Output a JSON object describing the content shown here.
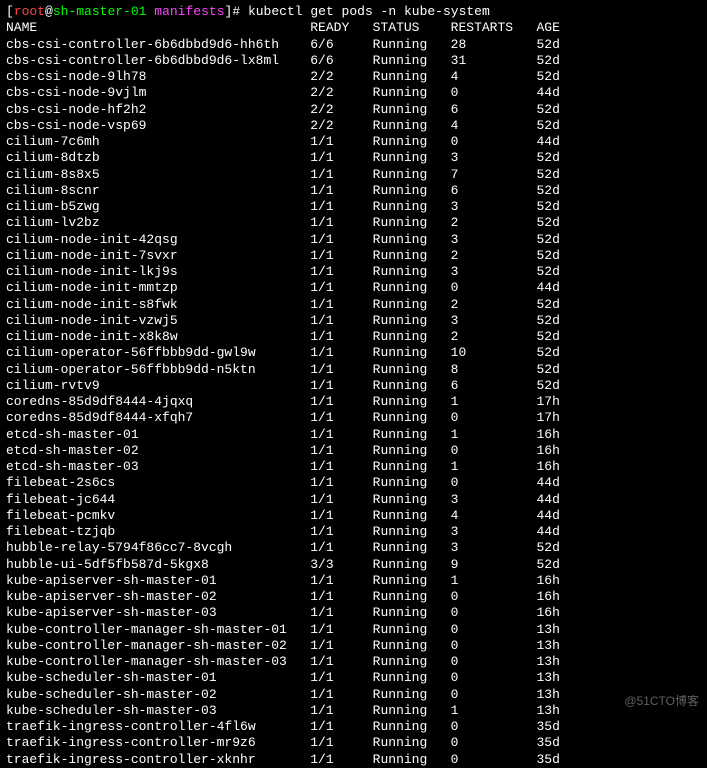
{
  "prompt": {
    "user": "root",
    "at": "@",
    "host": "sh-master-01",
    "space": " ",
    "path": "manifests",
    "hash": "#",
    "command": "kubectl get pods -n kube-system"
  },
  "headers": [
    "NAME",
    "READY",
    "STATUS",
    "RESTARTS",
    "AGE"
  ],
  "rows": [
    {
      "name": "cbs-csi-controller-6b6dbbd9d6-hh6th",
      "ready": "6/6",
      "status": "Running",
      "restarts": "28",
      "age": "52d"
    },
    {
      "name": "cbs-csi-controller-6b6dbbd9d6-lx8ml",
      "ready": "6/6",
      "status": "Running",
      "restarts": "31",
      "age": "52d"
    },
    {
      "name": "cbs-csi-node-9lh78",
      "ready": "2/2",
      "status": "Running",
      "restarts": "4",
      "age": "52d"
    },
    {
      "name": "cbs-csi-node-9vjlm",
      "ready": "2/2",
      "status": "Running",
      "restarts": "0",
      "age": "44d"
    },
    {
      "name": "cbs-csi-node-hf2h2",
      "ready": "2/2",
      "status": "Running",
      "restarts": "6",
      "age": "52d"
    },
    {
      "name": "cbs-csi-node-vsp69",
      "ready": "2/2",
      "status": "Running",
      "restarts": "4",
      "age": "52d"
    },
    {
      "name": "cilium-7c6mh",
      "ready": "1/1",
      "status": "Running",
      "restarts": "0",
      "age": "44d"
    },
    {
      "name": "cilium-8dtzb",
      "ready": "1/1",
      "status": "Running",
      "restarts": "3",
      "age": "52d"
    },
    {
      "name": "cilium-8s8x5",
      "ready": "1/1",
      "status": "Running",
      "restarts": "7",
      "age": "52d"
    },
    {
      "name": "cilium-8scnr",
      "ready": "1/1",
      "status": "Running",
      "restarts": "6",
      "age": "52d"
    },
    {
      "name": "cilium-b5zwg",
      "ready": "1/1",
      "status": "Running",
      "restarts": "3",
      "age": "52d"
    },
    {
      "name": "cilium-lv2bz",
      "ready": "1/1",
      "status": "Running",
      "restarts": "2",
      "age": "52d"
    },
    {
      "name": "cilium-node-init-42qsg",
      "ready": "1/1",
      "status": "Running",
      "restarts": "3",
      "age": "52d"
    },
    {
      "name": "cilium-node-init-7svxr",
      "ready": "1/1",
      "status": "Running",
      "restarts": "2",
      "age": "52d"
    },
    {
      "name": "cilium-node-init-lkj9s",
      "ready": "1/1",
      "status": "Running",
      "restarts": "3",
      "age": "52d"
    },
    {
      "name": "cilium-node-init-mmtzp",
      "ready": "1/1",
      "status": "Running",
      "restarts": "0",
      "age": "44d"
    },
    {
      "name": "cilium-node-init-s8fwk",
      "ready": "1/1",
      "status": "Running",
      "restarts": "2",
      "age": "52d"
    },
    {
      "name": "cilium-node-init-vzwj5",
      "ready": "1/1",
      "status": "Running",
      "restarts": "3",
      "age": "52d"
    },
    {
      "name": "cilium-node-init-x8k8w",
      "ready": "1/1",
      "status": "Running",
      "restarts": "2",
      "age": "52d"
    },
    {
      "name": "cilium-operator-56ffbbb9dd-gwl9w",
      "ready": "1/1",
      "status": "Running",
      "restarts": "10",
      "age": "52d"
    },
    {
      "name": "cilium-operator-56ffbbb9dd-n5ktn",
      "ready": "1/1",
      "status": "Running",
      "restarts": "8",
      "age": "52d"
    },
    {
      "name": "cilium-rvtv9",
      "ready": "1/1",
      "status": "Running",
      "restarts": "6",
      "age": "52d"
    },
    {
      "name": "coredns-85d9df8444-4jqxq",
      "ready": "1/1",
      "status": "Running",
      "restarts": "1",
      "age": "17h"
    },
    {
      "name": "coredns-85d9df8444-xfqh7",
      "ready": "1/1",
      "status": "Running",
      "restarts": "0",
      "age": "17h"
    },
    {
      "name": "etcd-sh-master-01",
      "ready": "1/1",
      "status": "Running",
      "restarts": "1",
      "age": "16h"
    },
    {
      "name": "etcd-sh-master-02",
      "ready": "1/1",
      "status": "Running",
      "restarts": "0",
      "age": "16h"
    },
    {
      "name": "etcd-sh-master-03",
      "ready": "1/1",
      "status": "Running",
      "restarts": "1",
      "age": "16h"
    },
    {
      "name": "filebeat-2s6cs",
      "ready": "1/1",
      "status": "Running",
      "restarts": "0",
      "age": "44d"
    },
    {
      "name": "filebeat-jc644",
      "ready": "1/1",
      "status": "Running",
      "restarts": "3",
      "age": "44d"
    },
    {
      "name": "filebeat-pcmkv",
      "ready": "1/1",
      "status": "Running",
      "restarts": "4",
      "age": "44d"
    },
    {
      "name": "filebeat-tzjqb",
      "ready": "1/1",
      "status": "Running",
      "restarts": "3",
      "age": "44d"
    },
    {
      "name": "hubble-relay-5794f86cc7-8vcgh",
      "ready": "1/1",
      "status": "Running",
      "restarts": "3",
      "age": "52d"
    },
    {
      "name": "hubble-ui-5df5fb587d-5kgx8",
      "ready": "3/3",
      "status": "Running",
      "restarts": "9",
      "age": "52d"
    },
    {
      "name": "kube-apiserver-sh-master-01",
      "ready": "1/1",
      "status": "Running",
      "restarts": "1",
      "age": "16h"
    },
    {
      "name": "kube-apiserver-sh-master-02",
      "ready": "1/1",
      "status": "Running",
      "restarts": "0",
      "age": "16h"
    },
    {
      "name": "kube-apiserver-sh-master-03",
      "ready": "1/1",
      "status": "Running",
      "restarts": "0",
      "age": "16h"
    },
    {
      "name": "kube-controller-manager-sh-master-01",
      "ready": "1/1",
      "status": "Running",
      "restarts": "0",
      "age": "13h"
    },
    {
      "name": "kube-controller-manager-sh-master-02",
      "ready": "1/1",
      "status": "Running",
      "restarts": "0",
      "age": "13h"
    },
    {
      "name": "kube-controller-manager-sh-master-03",
      "ready": "1/1",
      "status": "Running",
      "restarts": "0",
      "age": "13h"
    },
    {
      "name": "kube-scheduler-sh-master-01",
      "ready": "1/1",
      "status": "Running",
      "restarts": "0",
      "age": "13h"
    },
    {
      "name": "kube-scheduler-sh-master-02",
      "ready": "1/1",
      "status": "Running",
      "restarts": "0",
      "age": "13h"
    },
    {
      "name": "kube-scheduler-sh-master-03",
      "ready": "1/1",
      "status": "Running",
      "restarts": "1",
      "age": "13h"
    },
    {
      "name": "traefik-ingress-controller-4fl6w",
      "ready": "1/1",
      "status": "Running",
      "restarts": "0",
      "age": "35d"
    },
    {
      "name": "traefik-ingress-controller-mr9z6",
      "ready": "1/1",
      "status": "Running",
      "restarts": "0",
      "age": "35d"
    },
    {
      "name": "traefik-ingress-controller-xknhr",
      "ready": "1/1",
      "status": "Running",
      "restarts": "0",
      "age": "35d"
    }
  ],
  "watermark": "@51CTO博客",
  "col_widths": {
    "name": 39,
    "ready": 8,
    "status": 10,
    "restarts": 11,
    "age": 5
  }
}
